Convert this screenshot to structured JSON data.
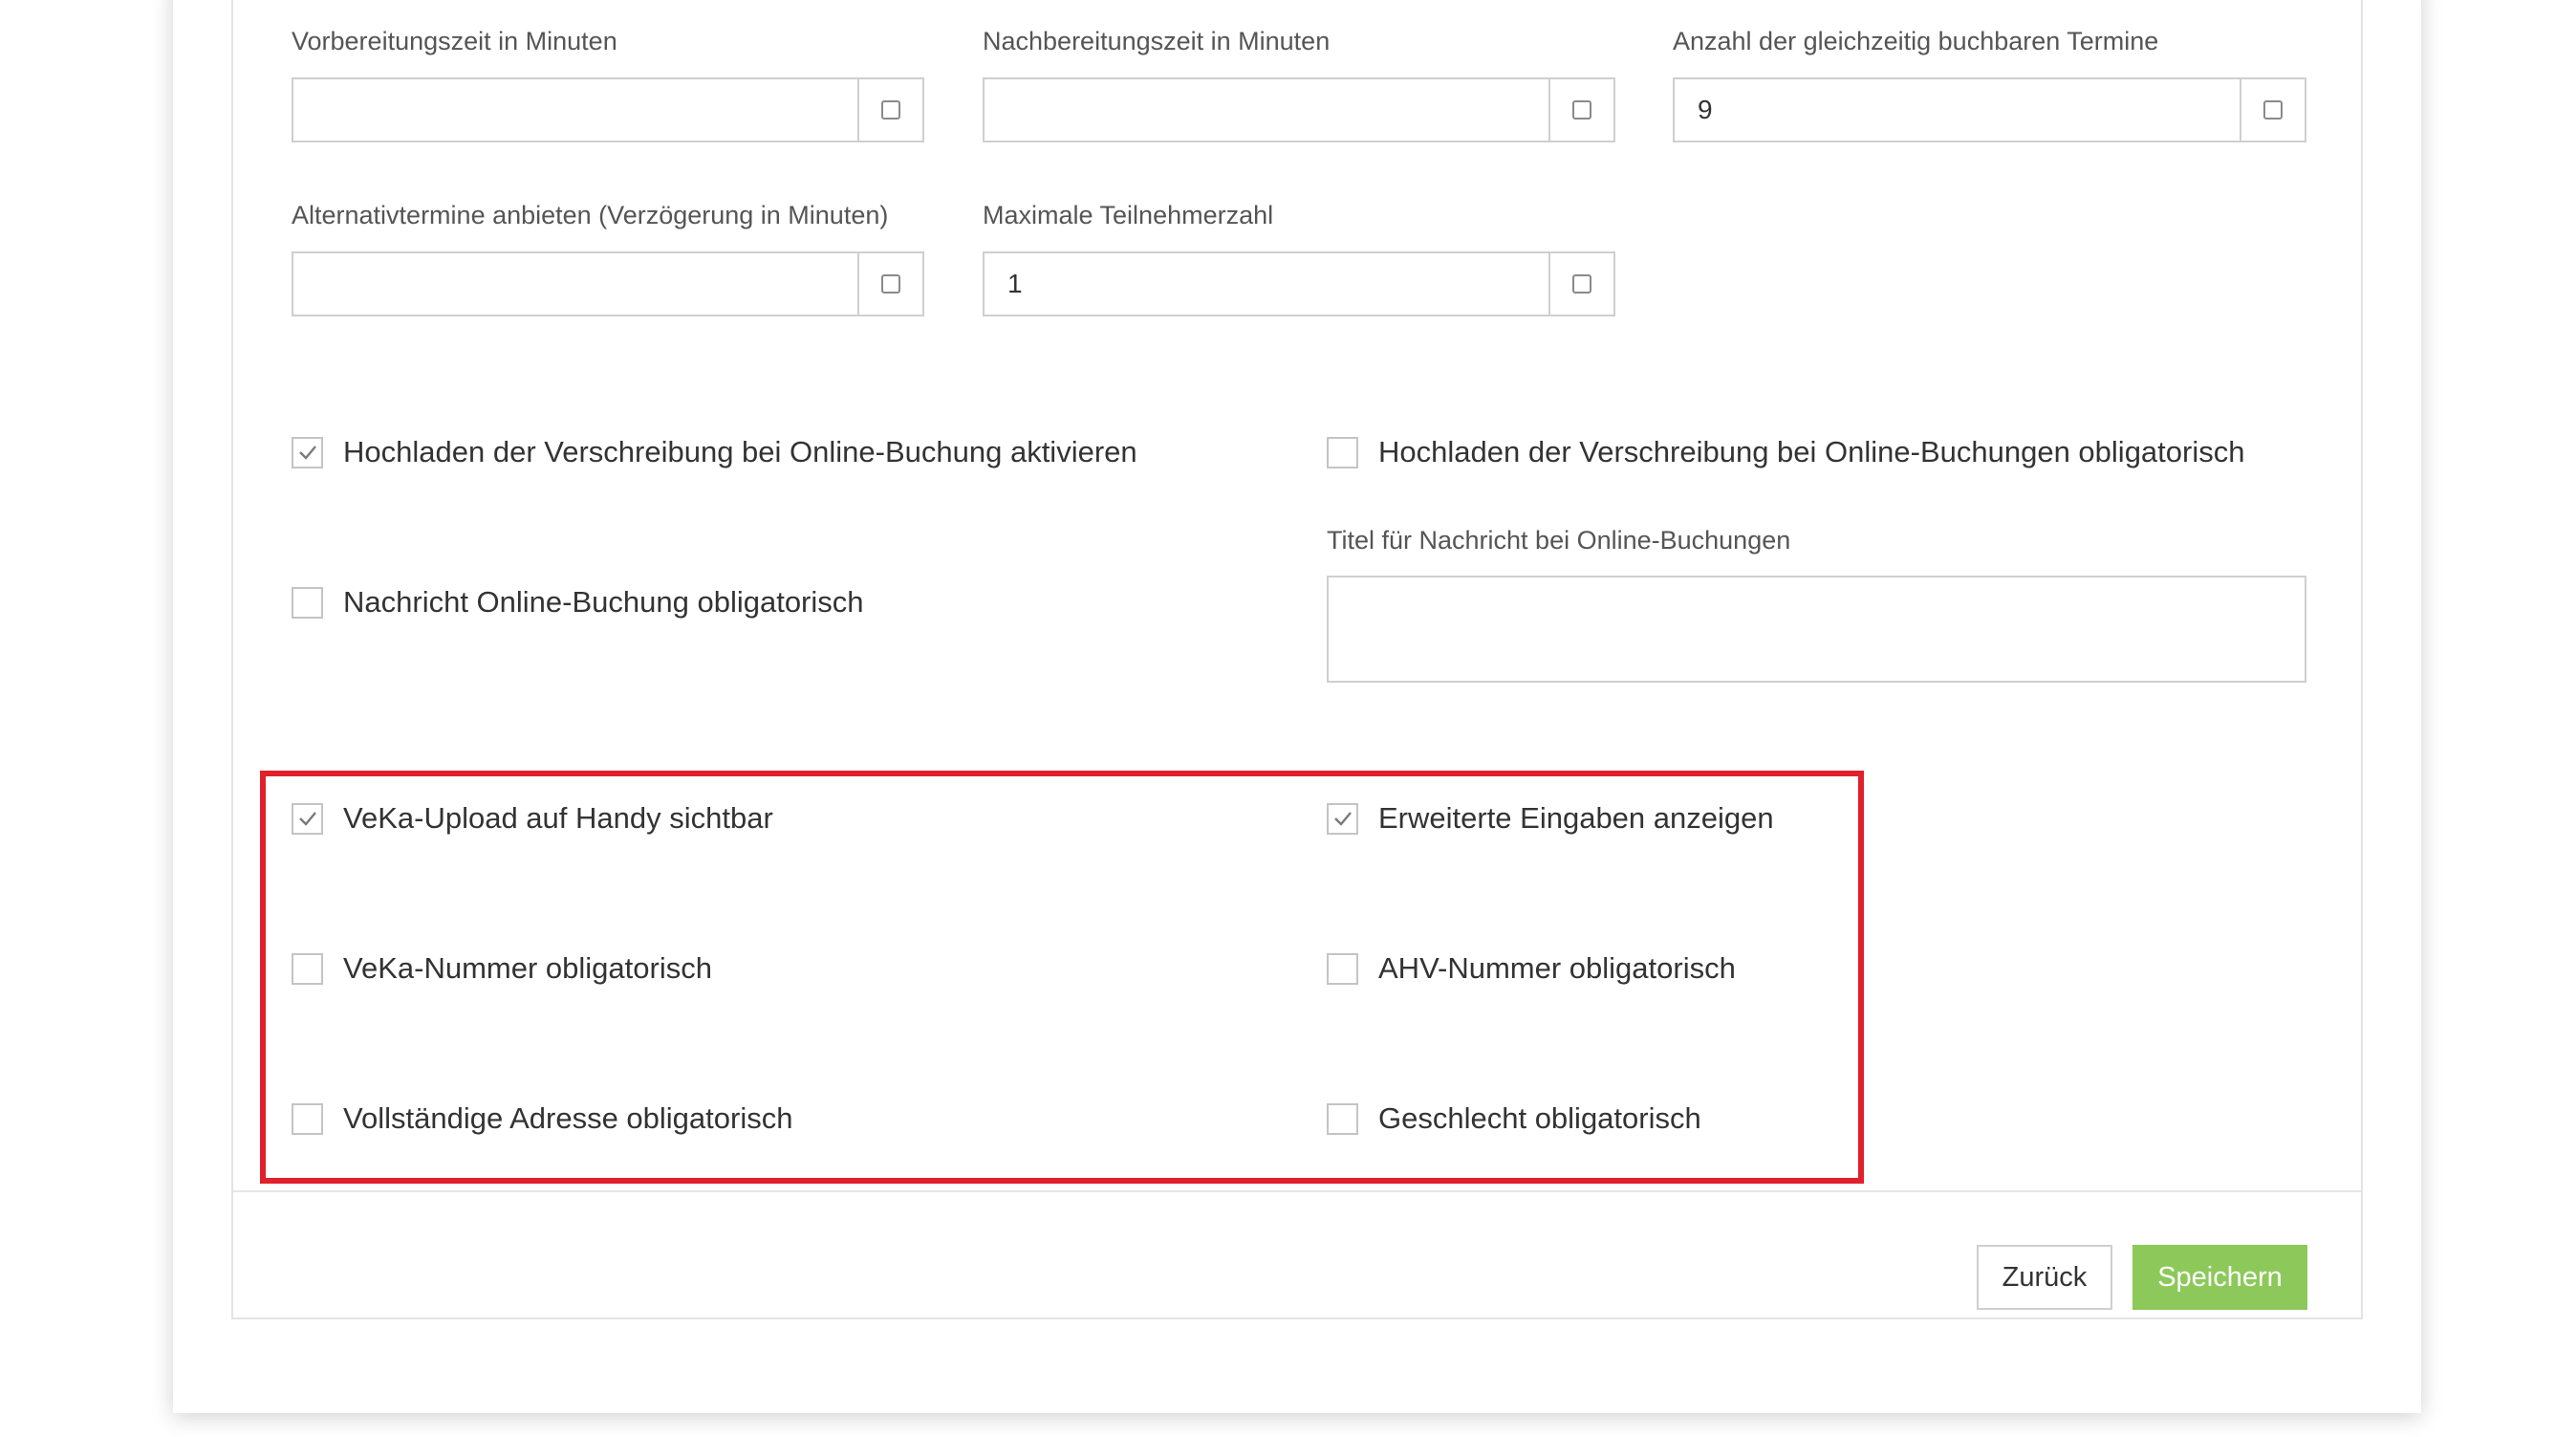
{
  "fields": {
    "prep_time": {
      "label": "Vorbereitungszeit in Minuten",
      "value": ""
    },
    "followup_time": {
      "label": "Nachbereitungszeit in Minuten",
      "value": ""
    },
    "concurrent_bookings": {
      "label": "Anzahl der gleichzeitig buchbaren Termine",
      "value": "9"
    },
    "alternative_delay": {
      "label": "Alternativtermine anbieten (Verzögerung in Minuten)",
      "value": ""
    },
    "max_participants": {
      "label": "Maximale Teilnehmerzahl",
      "value": "1"
    }
  },
  "checkboxes": {
    "upload_prescription": {
      "label": "Hochladen der Verschreibung bei Online-Buchung aktivieren",
      "checked": true
    },
    "upload_prescription_required": {
      "label": "Hochladen der Verschreibung bei Online-Buchungen obligatorisch",
      "checked": false
    },
    "message_required": {
      "label": "Nachricht Online-Buchung obligatorisch",
      "checked": false
    },
    "veka_upload_mobile": {
      "label": "VeKa-Upload auf Handy sichtbar",
      "checked": true
    },
    "extended_inputs": {
      "label": "Erweiterte Eingaben anzeigen",
      "checked": true
    },
    "veka_number_required": {
      "label": "VeKa-Nummer obligatorisch",
      "checked": false
    },
    "ahv_number_required": {
      "label": "AHV-Nummer obligatorisch",
      "checked": false
    },
    "full_address_required": {
      "label": "Vollständige Adresse obligatorisch",
      "checked": false
    },
    "gender_required": {
      "label": "Geschlecht obligatorisch",
      "checked": false
    }
  },
  "message_title": {
    "label": "Titel für Nachricht bei Online-Buchungen",
    "value": ""
  },
  "buttons": {
    "back": "Zurück",
    "save": "Speichern"
  },
  "colors": {
    "highlight": "#e0202b",
    "save_button": "#8cc95a",
    "border": "#cfcfcf"
  }
}
